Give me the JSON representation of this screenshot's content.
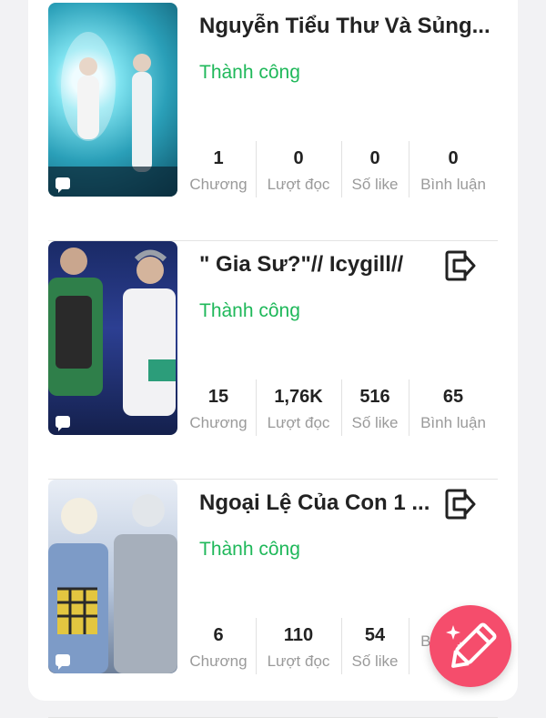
{
  "stat_labels": {
    "chapters": "Chương",
    "reads": "Lượt đọc",
    "likes": "Số like",
    "comments": "Bình luận"
  },
  "stories": [
    {
      "title": "Nguyễn Tiểu Thư Và Sủng...",
      "status": "Thành công",
      "chapters": "1",
      "reads": "0",
      "likes": "0",
      "comments": "0"
    },
    {
      "title": "\" Gia Sư?\"// Icygill//",
      "status": "Thành công",
      "chapters": "15",
      "reads": "1,76K",
      "likes": "516",
      "comments": "65",
      "icon": "exit-icon"
    },
    {
      "title": "Ngoại Lệ Của Con 1 ...",
      "status": "Thành công",
      "chapters": "6",
      "reads": "110",
      "likes": "54",
      "comments": "",
      "icon": "exit-icon"
    }
  ],
  "fab": {
    "icon": "pencil-sparkle-icon",
    "color": "#f54d6c"
  },
  "colors": {
    "status": "#1fb85a",
    "accent": "#f54d6c"
  }
}
